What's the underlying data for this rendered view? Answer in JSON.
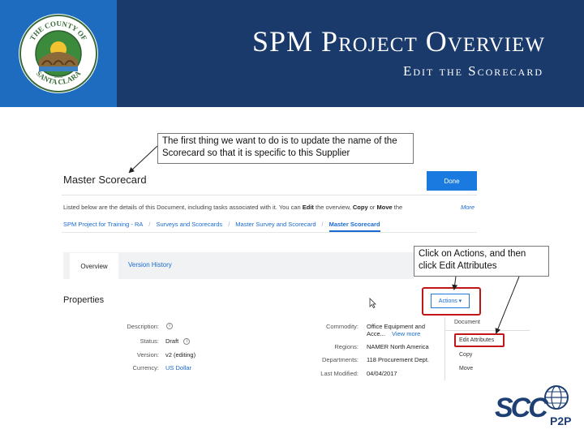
{
  "header": {
    "title": "SPM Project Overview",
    "subtitle": "Edit the Scorecard",
    "seal": {
      "top_text": "THE COUNTY OF",
      "bottom_text": "SANTA CLARA",
      "year": "1850"
    },
    "colors": {
      "band": "#1a3a6b",
      "logo_panel": "#1d6cc0"
    }
  },
  "callouts": {
    "first": "The first thing we want to do is to update the name of the Scorecard so that it is specific to this Supplier",
    "second": "Click on Actions, and then click Edit Attributes"
  },
  "document": {
    "title": "Master Scorecard",
    "done_label": "Done",
    "intro": {
      "prefix": "Listed below are the details of this Document, including tasks associated with it. You can ",
      "edit": "Edit",
      "mid1": " the overview, ",
      "copy": "Copy",
      "mid2": " or ",
      "move": "Move",
      "suffix": " the"
    },
    "more": "More",
    "breadcrumbs": [
      "SPM Project for Training - RA",
      "Surveys and Scorecards",
      "Master Survey and Scorecard",
      "Master Scorecard"
    ],
    "tabs": [
      "Overview",
      "Version History"
    ],
    "properties_title": "Properties",
    "actions_label": "Actions ▾",
    "left_props": [
      {
        "label": "Description:",
        "value": ""
      },
      {
        "label": "Status:",
        "value": "Draft"
      },
      {
        "label": "Version:",
        "value": "v2 (editing)"
      },
      {
        "label": "Currency:",
        "value": "US Dollar"
      }
    ],
    "right_props": [
      {
        "label": "Commodity:",
        "value": "Office Equipment and",
        "value2": "Acce...",
        "link": "View more"
      },
      {
        "label": "Regions:",
        "value": "NAMER North America"
      },
      {
        "label": "Departments:",
        "value": "118 Procurement Dept."
      },
      {
        "label": "Last Modified:",
        "value": "04/04/2017"
      }
    ],
    "menu": {
      "header": "Document",
      "items": [
        "Edit Attributes",
        "Copy",
        "Move"
      ]
    },
    "accent": "#1a7ae0",
    "highlight": "#c21515"
  },
  "footer_logo": {
    "text_main": "SCC",
    "text_sub": "P2P"
  }
}
